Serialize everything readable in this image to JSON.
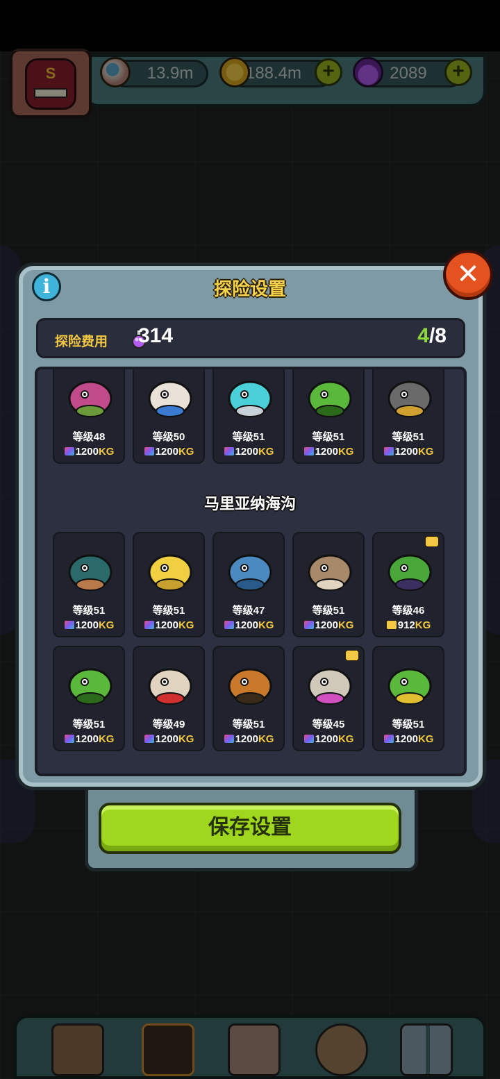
{
  "currencies": {
    "eyes": "13.9m",
    "coins": "188.4m",
    "potions": "2089"
  },
  "avatar": {
    "letter": "S"
  },
  "dialog": {
    "title": "探险设置",
    "cost_label": "探险费用",
    "cost_value": "314",
    "selected_count": "4",
    "capacity": "/8",
    "section_title": "马里亚纳海沟",
    "save_label": "保存设置"
  },
  "weight_unit": "KG",
  "prev_section_monsters": [
    {
      "level": "等级48",
      "weight": "1200",
      "icon": "onion-monster-icon"
    },
    {
      "level": "等级50",
      "weight": "1200",
      "icon": "milk-snail-icon"
    },
    {
      "level": "等级51",
      "weight": "1200",
      "icon": "bubble-fish-icon"
    },
    {
      "level": "等级51",
      "weight": "1200",
      "icon": "caterpillar-icon"
    },
    {
      "level": "等级51",
      "weight": "1200",
      "icon": "rock-monster-icon"
    }
  ],
  "mariana_monsters": [
    {
      "level": "等级51",
      "weight": "1200",
      "icon": "sea-urchin-plant-icon"
    },
    {
      "level": "等级51",
      "weight": "1200",
      "icon": "banana-squid-icon"
    },
    {
      "level": "等级47",
      "weight": "1200",
      "icon": "blue-crab-icon"
    },
    {
      "level": "等级51",
      "weight": "1200",
      "icon": "walrus-shell-icon"
    },
    {
      "level": "等级46",
      "weight": "912",
      "icon": "mantis-centipede-icon",
      "badge": true,
      "gold_bag": true
    },
    {
      "level": "等级51",
      "weight": "1200",
      "icon": "green-worm-icon"
    },
    {
      "level": "等级49",
      "weight": "1200",
      "icon": "hermit-clam-icon"
    },
    {
      "level": "等级51",
      "weight": "1200",
      "icon": "tiger-shrimp-icon"
    },
    {
      "level": "等级45",
      "weight": "1200",
      "icon": "pink-oyster-icon",
      "badge": true
    },
    {
      "level": "等级51",
      "weight": "1200",
      "icon": "seahorse-icon"
    }
  ],
  "colors": {
    "accent_gold": "#f3c842",
    "count_green": "#8ed83c",
    "save_button": "#9fd61e",
    "close_button": "#e3521f"
  }
}
